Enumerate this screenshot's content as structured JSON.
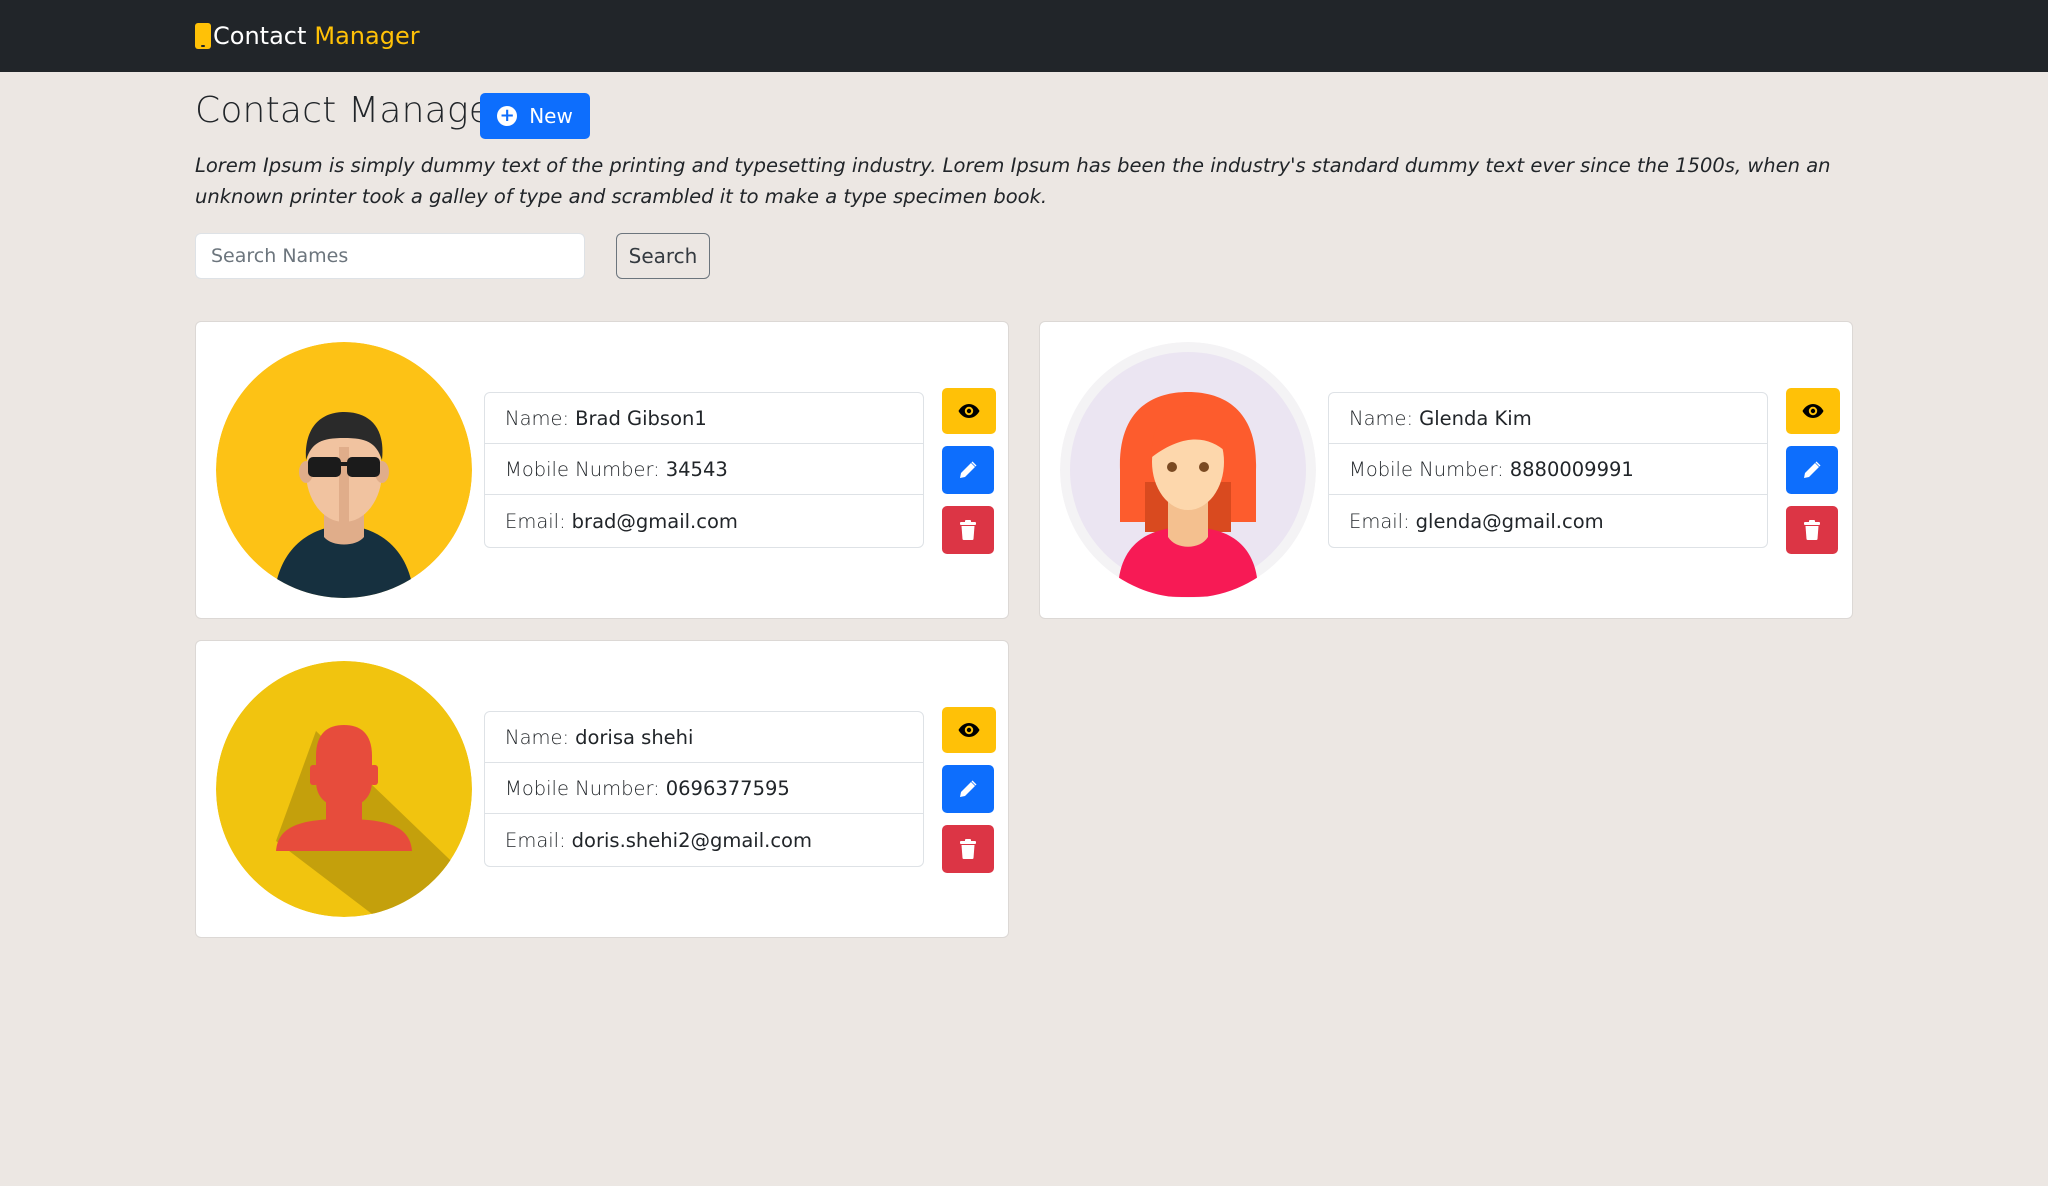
{
  "navbar": {
    "brand_word1": "Contact",
    "brand_word2": "Manager",
    "brand_icon": "mobile-phone-icon"
  },
  "header": {
    "title": "Contact Manager",
    "new_button_label": "New",
    "new_button_icon": "plus-circle-icon",
    "description": "Lorem Ipsum is simply dummy text of the printing and typesetting industry. Lorem Ipsum has been the industry's standard dummy text ever since the 1500s, when an unknown printer took a galley of type and scrambled it to make a type specimen book."
  },
  "search": {
    "placeholder": "Search Names",
    "value": "",
    "button_label": "Search"
  },
  "labels": {
    "name": "Name:",
    "mobile": "Mobile Number:",
    "email": "Email:"
  },
  "contacts": [
    {
      "name": "Brad Gibson1",
      "mobile": "34543",
      "email": "brad@gmail.com",
      "avatar": "man-sunglasses-avatar"
    },
    {
      "name": "Glenda Kim",
      "mobile": "8880009991",
      "email": "glenda@gmail.com",
      "avatar": "red-haired-woman-avatar"
    },
    {
      "name": "dorisa shehi",
      "mobile": "0696377595",
      "email": "doris.shehi2@gmail.com",
      "avatar": "generic-person-silhouette-avatar"
    }
  ],
  "action_icons": [
    "eye-icon",
    "pencil-icon",
    "trash-icon"
  ],
  "colors": {
    "navbar": "#212529",
    "background": "#ece7e3",
    "accent_yellow": "#ffc107",
    "primary_blue": "#0d6efd",
    "danger_red": "#dc3545"
  }
}
